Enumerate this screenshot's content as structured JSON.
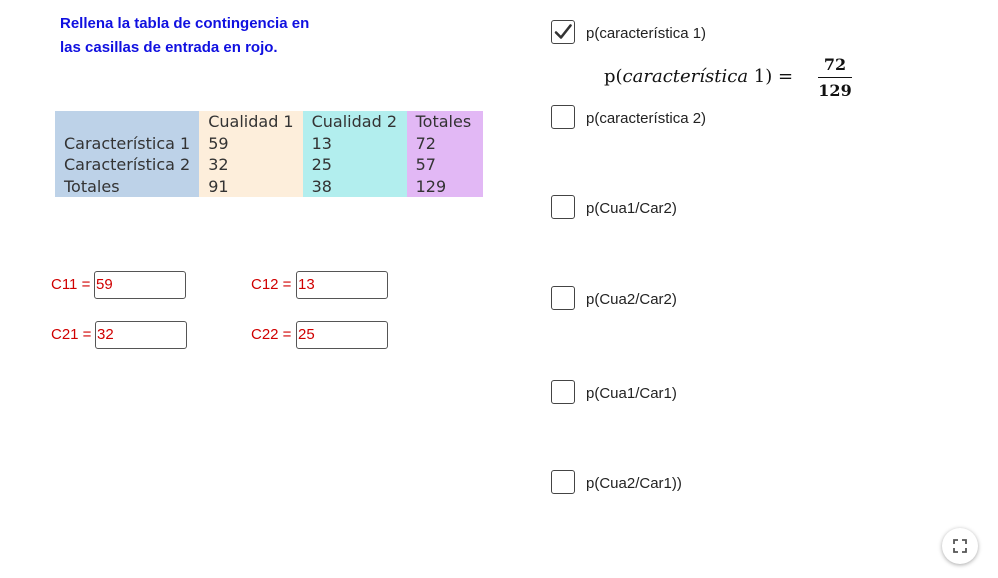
{
  "instructions": {
    "line1": "Rellena la tabla de contingencia en",
    "line2": "las casillas de entrada en rojo."
  },
  "table": {
    "headers": [
      "",
      "Cualidad 1",
      "Cualidad 2",
      "Totales"
    ],
    "rows": [
      [
        "Característica 1",
        "59",
        "13",
        "72"
      ],
      [
        "Característica 2",
        "32",
        "25",
        "57"
      ],
      [
        "Totales",
        "91",
        "38",
        "129"
      ]
    ]
  },
  "inputs": {
    "c11": {
      "label": "C11 =",
      "value": "59"
    },
    "c12": {
      "label": "C12 =",
      "value": "13"
    },
    "c21": {
      "label": "C21 =",
      "value": "32"
    },
    "c22": {
      "label": "C22 =",
      "value": "25"
    }
  },
  "checkboxes": [
    {
      "label": "p(característica 1)",
      "checked": true
    },
    {
      "label": "p(característica 2)",
      "checked": false
    },
    {
      "label": "p(Cua1/Car2)",
      "checked": false
    },
    {
      "label": "p(Cua2/Car2)",
      "checked": false
    },
    {
      "label": "p(Cua1/Car1)",
      "checked": false
    },
    {
      "label": "p(Cua2/Car1))",
      "checked": false
    }
  ],
  "formula": {
    "prefix": "p(",
    "word": "característica",
    "suffix": " 1) =",
    "numerator": "72",
    "denominator": "129"
  },
  "icons": {
    "checkmark": "check-icon",
    "fullscreen": "fullscreen-icon"
  },
  "colors": {
    "instruction_text": "#1010e0",
    "input_text": "#d00000",
    "row_header_bg": "#bdd2e8",
    "cualidad1_bg": "#fdeedb",
    "cualidad2_bg": "#b2eeee",
    "totales_bg": "#e2b8f5"
  }
}
